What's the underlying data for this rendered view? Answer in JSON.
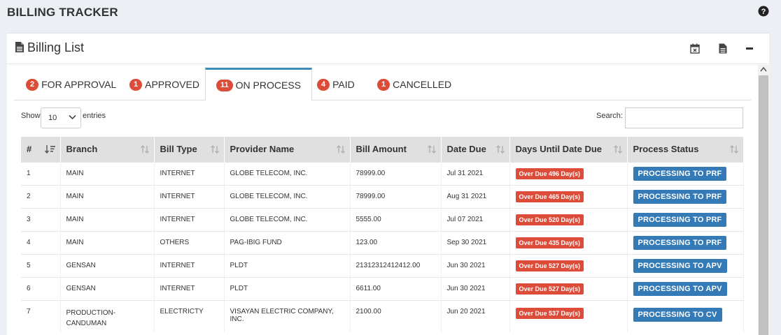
{
  "app": {
    "title": "BILLING TRACKER"
  },
  "card": {
    "title": "Billing List"
  },
  "tabs": [
    {
      "count": "2",
      "label": "FOR APPROVAL"
    },
    {
      "count": "1",
      "label": "APPROVED"
    },
    {
      "count": "11",
      "label": "ON PROCESS"
    },
    {
      "count": "4",
      "label": "PAID"
    },
    {
      "count": "1",
      "label": "CANCELLED"
    }
  ],
  "controls": {
    "show": "Show",
    "entries": "entries",
    "length": "10",
    "search": "Search:"
  },
  "columns": [
    "#",
    "Branch",
    "Bill Type",
    "Provider Name",
    "Bill Amount",
    "Date Due",
    "Days Until Date Due",
    "Process Status"
  ],
  "rows": [
    {
      "n": "1",
      "branch": "MAIN",
      "type": "INTERNET",
      "provider": "GLOBE TELECOM, INC.",
      "amount": "78999.00",
      "due": "Jul 31 2021",
      "days": "Over Due 496 Day(s)",
      "status": "PROCESSING TO PRF"
    },
    {
      "n": "2",
      "branch": "MAIN",
      "type": "INTERNET",
      "provider": "GLOBE TELECOM, INC.",
      "amount": "78999.00",
      "due": "Aug 31 2021",
      "days": "Over Due 465 Day(s)",
      "status": "PROCESSING TO PRF"
    },
    {
      "n": "3",
      "branch": "MAIN",
      "type": "INTERNET",
      "provider": "GLOBE TELECOM, INC.",
      "amount": "5555.00",
      "due": "Jul 07 2021",
      "days": "Over Due 520 Day(s)",
      "status": "PROCESSING TO PRF"
    },
    {
      "n": "4",
      "branch": "MAIN",
      "type": "OTHERS",
      "provider": "PAG-IBIG FUND",
      "amount": "123.00",
      "due": "Sep 30 2021",
      "days": "Over Due 435 Day(s)",
      "status": "PROCESSING TO PRF"
    },
    {
      "n": "5",
      "branch": "GENSAN",
      "type": "INTERNET",
      "provider": "PLDT",
      "amount": "21312312412412.00",
      "due": "Jun 30 2021",
      "days": "Over Due 527 Day(s)",
      "status": "PROCESSING TO APV"
    },
    {
      "n": "6",
      "branch": "GENSAN",
      "type": "INTERNET",
      "provider": "PLDT",
      "amount": "6611.00",
      "due": "Jun 30 2021",
      "days": "Over Due 527 Day(s)",
      "status": "PROCESSING TO APV"
    },
    {
      "n": "7",
      "branch": "PRODUCTION-CANDUMAN",
      "type": "ELECTRICTY",
      "provider": "VISAYAN ELECTRIC COMPANY, INC.",
      "amount": "2100.00",
      "due": "Jun 20 2021",
      "days": "Over Due 537 Day(s)",
      "status": "PROCESSING TO CV"
    }
  ],
  "icons": {
    "help": "question-circle-icon",
    "title": "document-icon",
    "tool1": "calendar-x-icon",
    "tool2": "document-icon",
    "collapse": "minus-icon"
  }
}
